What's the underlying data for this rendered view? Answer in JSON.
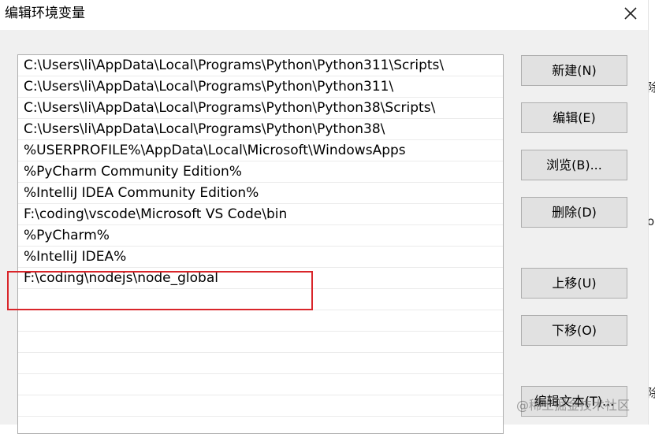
{
  "window": {
    "title": "编辑环境变量",
    "close_icon": "close-icon"
  },
  "paths": [
    "C:\\Users\\li\\AppData\\Local\\Programs\\Python\\Python311\\Scripts\\",
    "C:\\Users\\li\\AppData\\Local\\Programs\\Python\\Python311\\",
    "C:\\Users\\li\\AppData\\Local\\Programs\\Python\\Python38\\Scripts\\",
    "C:\\Users\\li\\AppData\\Local\\Programs\\Python\\Python38\\",
    "%USERPROFILE%\\AppData\\Local\\Microsoft\\WindowsApps",
    "%PyCharm Community Edition%",
    "%IntelliJ IDEA Community Edition%",
    "F:\\coding\\vscode\\Microsoft VS Code\\bin",
    "%PyCharm%",
    "%IntelliJ IDEA%",
    "F:\\coding\\nodejs\\node_global",
    "",
    "",
    "",
    "",
    "",
    ""
  ],
  "buttons": {
    "new": "新建(N)",
    "edit": "编辑(E)",
    "browse": "浏览(B)...",
    "delete": "删除(D)",
    "move_up": "上移(U)",
    "move_down": "下移(O)",
    "edit_text": "编辑文本(T)..."
  },
  "edge_fragments": [
    "除",
    "o",
    "除"
  ],
  "watermark": "@稀土掘金技术社区",
  "colors": {
    "highlight": "#d9252a",
    "dialog_bg": "#f0f0f0",
    "button_bg": "#e1e1e1"
  }
}
